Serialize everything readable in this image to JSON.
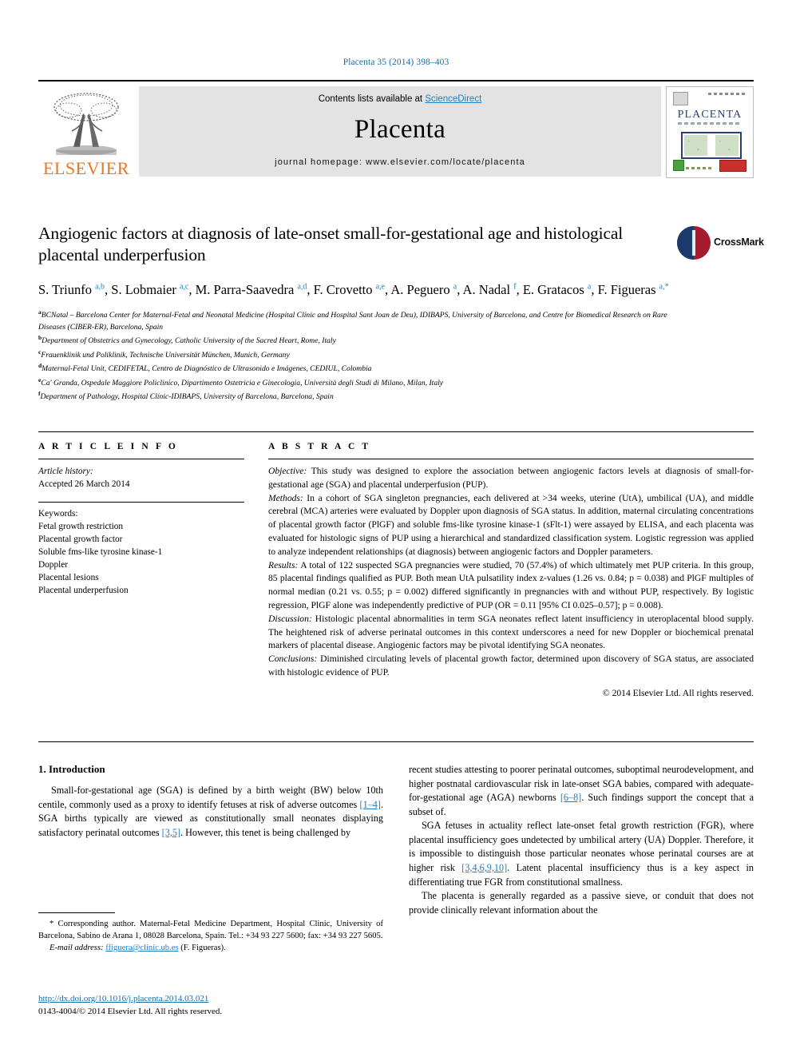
{
  "running_head": "Placenta 35 (2014) 398–403",
  "masthead": {
    "contents_prefix": "Contents lists available at ",
    "sciencedirect": "ScienceDirect",
    "journal_title": "Placenta",
    "homepage": "journal homepage: www.elsevier.com/locate/placenta",
    "publisher_wordmark": "ELSEVIER",
    "cover_title": "PLACENTA"
  },
  "article": {
    "title": "Angiogenic factors at diagnosis of late-onset small-for-gestational age and histological placental underperfusion",
    "crossmark_label": "CrossMark",
    "authors_html": "S. Triunfo <sup>a,b</sup>, S. Lobmaier <sup>a,c</sup>, M. Parra-Saavedra <sup>a,d</sup>, F. Crovetto <sup>a,e</sup>, A. Peguero <sup>a</sup>, A. Nadal <sup>f</sup>, E. Gratacos <sup>a</sup>, F. Figueras <sup>a,*</sup>",
    "affiliations": [
      {
        "mark": "a",
        "text": "BCNatal – Barcelona Center for Maternal-Fetal and Neonatal Medicine (Hospital Clínic and Hospital Sant Joan de Deu), IDIBAPS, University of Barcelona, and Centre for Biomedical Research on Rare Diseases (CIBER-ER), Barcelona, Spain"
      },
      {
        "mark": "b",
        "text": "Department of Obstetrics and Gynecology, Catholic University of the Sacred Heart, Rome, Italy"
      },
      {
        "mark": "c",
        "text": "Frauenklinik und Poliklinik, Technische Universität München, Munich, Germany"
      },
      {
        "mark": "d",
        "text": "Maternal-Fetal Unit, CEDIFETAL, Centro de Diagnóstico de Ultrasonido e Imágenes, CEDIUL, Colombia"
      },
      {
        "mark": "e",
        "text": "Ca' Granda, Ospedale Maggiore Policlinico, Dipartimento Ostetricia e Ginecologia, Università degli Studi di Milano, Milan, Italy"
      },
      {
        "mark": "f",
        "text": "Department of Pathology, Hospital Clínic-IDIBAPS, University of Barcelona, Barcelona, Spain"
      }
    ]
  },
  "article_info": {
    "heading": "A R T I C L E  I N F O",
    "history_label": "Article history:",
    "history_value": "Accepted 26 March 2014",
    "keywords_label": "Keywords:",
    "keywords": [
      "Fetal growth restriction",
      "Placental growth factor",
      "Soluble fms-like tyrosine kinase-1",
      "Doppler",
      "Placental lesions",
      "Placental underperfusion"
    ]
  },
  "abstract": {
    "heading": "A B S T R A C T",
    "sections": [
      {
        "label": "Objective:",
        "text": " This study was designed to explore the association between angiogenic factors levels at diagnosis of small-for-gestational age (SGA) and placental underperfusion (PUP)."
      },
      {
        "label": "Methods:",
        "text": " In a cohort of SGA singleton pregnancies, each delivered at >34 weeks, uterine (UtA), umbilical (UA), and middle cerebral (MCA) arteries were evaluated by Doppler upon diagnosis of SGA status. In addition, maternal circulating concentrations of placental growth factor (PlGF) and soluble fms-like tyrosine kinase-1 (sFlt-1) were assayed by ELISA, and each placenta was evaluated for histologic signs of PUP using a hierarchical and standardized classification system. Logistic regression was applied to analyze independent relationships (at diagnosis) between angiogenic factors and Doppler parameters."
      },
      {
        "label": "Results:",
        "text": " A total of 122 suspected SGA pregnancies were studied, 70 (57.4%) of which ultimately met PUP criteria. In this group, 85 placental findings qualified as PUP. Both mean UtA pulsatility index z-values (1.26 vs. 0.84; p = 0.038) and PlGF multiples of normal median (0.21 vs. 0.55; p = 0.002) differed significantly in pregnancies with and without PUP, respectively. By logistic regression, PlGF alone was independently predictive of PUP (OR = 0.11 [95% CI 0.025–0.57]; p = 0.008)."
      },
      {
        "label": "Discussion:",
        "text": " Histologic placental abnormalities in term SGA neonates reflect latent insufficiency in uteroplacental blood supply. The heightened risk of adverse perinatal outcomes in this context underscores a need for new Doppler or biochemical prenatal markers of placental disease. Angiogenic factors may be pivotal identifying SGA neonates."
      },
      {
        "label": "Conclusions:",
        "text": " Diminished circulating levels of placental growth factor, determined upon discovery of SGA status, are associated with histologic evidence of PUP."
      }
    ],
    "copyright": "© 2014 Elsevier Ltd. All rights reserved."
  },
  "body": {
    "section_number_title": "1.  Introduction",
    "left_paragraphs": [
      {
        "segments": [
          {
            "t": "Small-for-gestational age (SGA) is defined by a birth weight (BW) below 10th centile, commonly used as a proxy to identify fetuses at risk of adverse outcomes ",
            "r": false
          },
          {
            "t": "[1–4]",
            "r": true
          },
          {
            "t": ". SGA births typically are viewed as constitutionally small neonates displaying satisfactory perinatal outcomes ",
            "r": false
          },
          {
            "t": "[3,5]",
            "r": true
          },
          {
            "t": ". However, this tenet is being challenged by",
            "r": false
          }
        ]
      }
    ],
    "right_paragraphs": [
      {
        "indent": false,
        "segments": [
          {
            "t": "recent studies attesting to poorer perinatal outcomes, suboptimal neurodevelopment, and higher postnatal cardiovascular risk in late-onset SGA babies, compared with adequate-for-gestational age (AGA) newborns ",
            "r": false
          },
          {
            "t": "[6–8]",
            "r": true
          },
          {
            "t": ". Such findings support the concept that a subset of.",
            "r": false
          }
        ]
      },
      {
        "indent": true,
        "segments": [
          {
            "t": "SGA fetuses in actuality reflect late-onset fetal growth restriction (FGR), where placental insufficiency goes undetected by umbilical artery (UA) Doppler. Therefore, it is impossible to distinguish those particular neonates whose perinatal courses are at higher risk ",
            "r": false
          },
          {
            "t": "[3,4,6,9,10]",
            "r": true
          },
          {
            "t": ". Latent placental insufficiency thus is a key aspect in differentiating true FGR from constitutional smallness.",
            "r": false
          }
        ]
      },
      {
        "indent": true,
        "segments": [
          {
            "t": "The placenta is generally regarded as a passive sieve, or conduit that does not provide clinically relevant information about the",
            "r": false
          }
        ]
      }
    ]
  },
  "footnote": {
    "corresponding": "* Corresponding author. Maternal-Fetal Medicine Department, Hospital Clinic, University of Barcelona, Sabino de Arana 1, 08028 Barcelona, Spain. Tel.: +34 93 227 5600; fax: +34 93 227 5605.",
    "email_label": "E-mail address:",
    "email": "ffiguera@clinic.ub.es",
    "email_suffix": " (F. Figueras)."
  },
  "footer": {
    "doi": "http://dx.doi.org/10.1016/j.placenta.2014.03.021",
    "issn_line": "0143-4004/© 2014 Elsevier Ltd. All rights reserved."
  },
  "colors": {
    "link_blue": "#1f7fbf",
    "running_head_blue": "#1270a8",
    "elsevier_orange": "#E87722",
    "masthead_gray": "#e3e3e3"
  }
}
